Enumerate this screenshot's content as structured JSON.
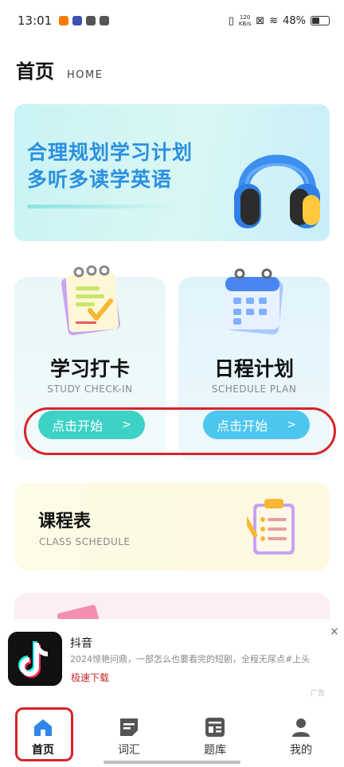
{
  "status_bar": {
    "time": "13:01",
    "netspeed_value": "120",
    "netspeed_unit": "KB/s",
    "battery": "48%",
    "battery_level": 0.48
  },
  "header": {
    "title": "首页",
    "subtitle": "HOME"
  },
  "banner": {
    "line1": "合理规划学习计划",
    "line2": "多听多读学英语"
  },
  "cards": [
    {
      "title": "学习打卡",
      "subtitle": "STUDY CHECK-IN",
      "button": "点击开始",
      "chevron": ">"
    },
    {
      "title": "日程计划",
      "subtitle": "SCHEDULE PLAN",
      "button": "点击开始",
      "chevron": ">"
    }
  ],
  "class_schedule": {
    "title": "课程表",
    "subtitle": "CLASS SCHEDULE"
  },
  "ad": {
    "app_name": "抖音",
    "description": "2024惊艳问鼎，一部怎么也要看完的短剧，全程无尿点#上头",
    "action": "极速下载",
    "close": "×",
    "tag": "广告"
  },
  "nav": {
    "items": [
      {
        "label": "首页",
        "icon": "home-icon"
      },
      {
        "label": "词汇",
        "icon": "vocabulary-icon"
      },
      {
        "label": "题库",
        "icon": "question-bank-icon"
      },
      {
        "label": "我的",
        "icon": "profile-icon"
      }
    ]
  },
  "colors": {
    "accent_teal": "#3ed2c6",
    "accent_blue": "#4cc6ef",
    "banner_text": "#2a8fe0",
    "annotation_red": "#d8232a"
  }
}
